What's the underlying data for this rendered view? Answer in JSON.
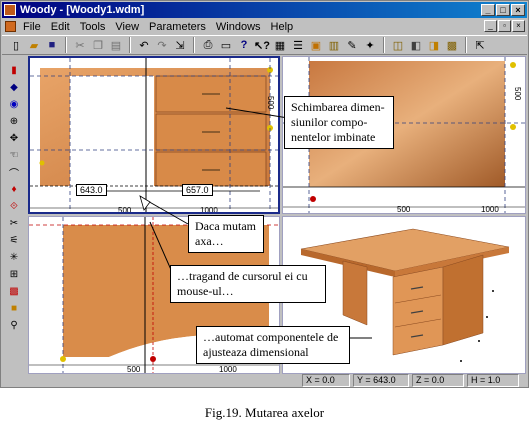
{
  "window": {
    "title": "Woody - [Woody1.wdm]"
  },
  "menu": [
    "File",
    "Edit",
    "Tools",
    "View",
    "Parameters",
    "Windows",
    "Help"
  ],
  "toolbar_icons": [
    "new-icon",
    "open-icon",
    "save-icon",
    "cut-icon",
    "copy-icon",
    "paste-icon",
    "undo-icon",
    "redo-icon",
    "export-icon",
    "print-icon",
    "preview-icon",
    "help-icon",
    "context-help-icon",
    "grid-icon",
    "layers-icon",
    "render-icon",
    "material-icon",
    "tools-icon",
    "view-icon",
    "window-icon",
    "component-icon",
    "copy-component-icon",
    "pointer-icon"
  ],
  "left_tools": [
    "select-icon",
    "move-icon",
    "rotate-icon",
    "zoom-icon",
    "pan-icon",
    "hand-icon",
    "measure-icon",
    "light-icon",
    "paint-icon",
    "tape-icon",
    "link-icon",
    "axis-icon",
    "view-3d-icon",
    "box-icon",
    "material-icon",
    "pin-icon"
  ],
  "viewports": {
    "front": {
      "dim_left": "643.0",
      "dim_right": "657.0",
      "ruler_x": [
        "500",
        "1000"
      ],
      "ruler_y": "500"
    },
    "side": {
      "ruler_x": [
        "500",
        "1000"
      ],
      "ruler_y": "500"
    },
    "top": {
      "ruler_x": [
        "500",
        "1000"
      ]
    }
  },
  "callouts": {
    "c1": "Schimbarea dimen-siunilor compo-nentelor imbinate",
    "c2": "Daca mutam axa…",
    "c3": "…tragand de cursorul ei cu mouse-ul…",
    "c4": "…automat componentele de ajusteaza dimensional"
  },
  "status": {
    "x": "X = 0.0",
    "y": "Y = 643.0",
    "z": "Z = 0.0",
    "h": "H = 1.0"
  },
  "caption": "Fig.19. Mutarea axelor"
}
